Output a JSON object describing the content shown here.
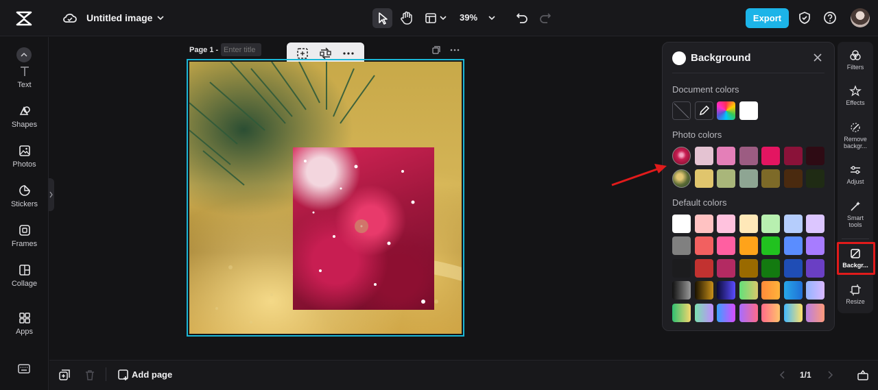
{
  "topbar": {
    "doc_title": "Untitled image",
    "zoom": "39%",
    "export_label": "Export"
  },
  "sidebar": {
    "items": [
      {
        "label": "Text",
        "icon": "text-icon"
      },
      {
        "label": "Shapes",
        "icon": "shapes-icon"
      },
      {
        "label": "Photos",
        "icon": "photos-icon"
      },
      {
        "label": "Stickers",
        "icon": "stickers-icon"
      },
      {
        "label": "Frames",
        "icon": "frames-icon"
      },
      {
        "label": "Collage",
        "icon": "collage-icon"
      },
      {
        "label": "Apps",
        "icon": "apps-icon"
      }
    ]
  },
  "canvas": {
    "page_label": "Page 1 -",
    "title_placeholder": "Enter title"
  },
  "panel": {
    "title": "Background",
    "document_colors_label": "Document colors",
    "photo_colors_label": "Photo colors",
    "default_colors_label": "Default colors",
    "photo_colors_row1": [
      "#e4c3d2",
      "#e47fb8",
      "#9c5c82",
      "#e31561",
      "#8a1239",
      "#2e0b14"
    ],
    "photo_colors_row2": [
      "#e0c56d",
      "#a9b67a",
      "#8ea593",
      "#7d6a28",
      "#4a2a0f",
      "#1f2b14"
    ],
    "default_colors": [
      [
        "#ffffff",
        "#ffc2c2",
        "#ffc2de",
        "#ffe8b8",
        "#b8f0b0",
        "#b5cdfc",
        "#dcc6ff"
      ],
      [
        "#808080",
        "#f26060",
        "#ff5fa1",
        "#ffa31a",
        "#21c21f",
        "#5a8dff",
        "#a77cff"
      ],
      [
        "#1c1c1e",
        "#c23230",
        "#b32a62",
        "#9a6a00",
        "#137a10",
        "#1f4db5",
        "#6a3fc4"
      ]
    ]
  },
  "rightrail": {
    "items": [
      {
        "label": "Filters",
        "icon": "filters-icon"
      },
      {
        "label": "Effects",
        "icon": "effects-icon"
      },
      {
        "label": "Remove backgr...",
        "icon": "remove-background-icon"
      },
      {
        "label": "Adjust",
        "icon": "adjust-icon"
      },
      {
        "label": "Smart tools",
        "icon": "smart-tools-icon"
      },
      {
        "label": "Backgr...",
        "icon": "background-icon"
      },
      {
        "label": "Resize",
        "icon": "resize-icon"
      }
    ]
  },
  "bottombar": {
    "add_page_label": "Add page",
    "page_count": "1/1"
  },
  "colors": {
    "accent": "#1cb4e8",
    "selection": "#1bb7d6",
    "annotation_red": "#e11b1b"
  }
}
